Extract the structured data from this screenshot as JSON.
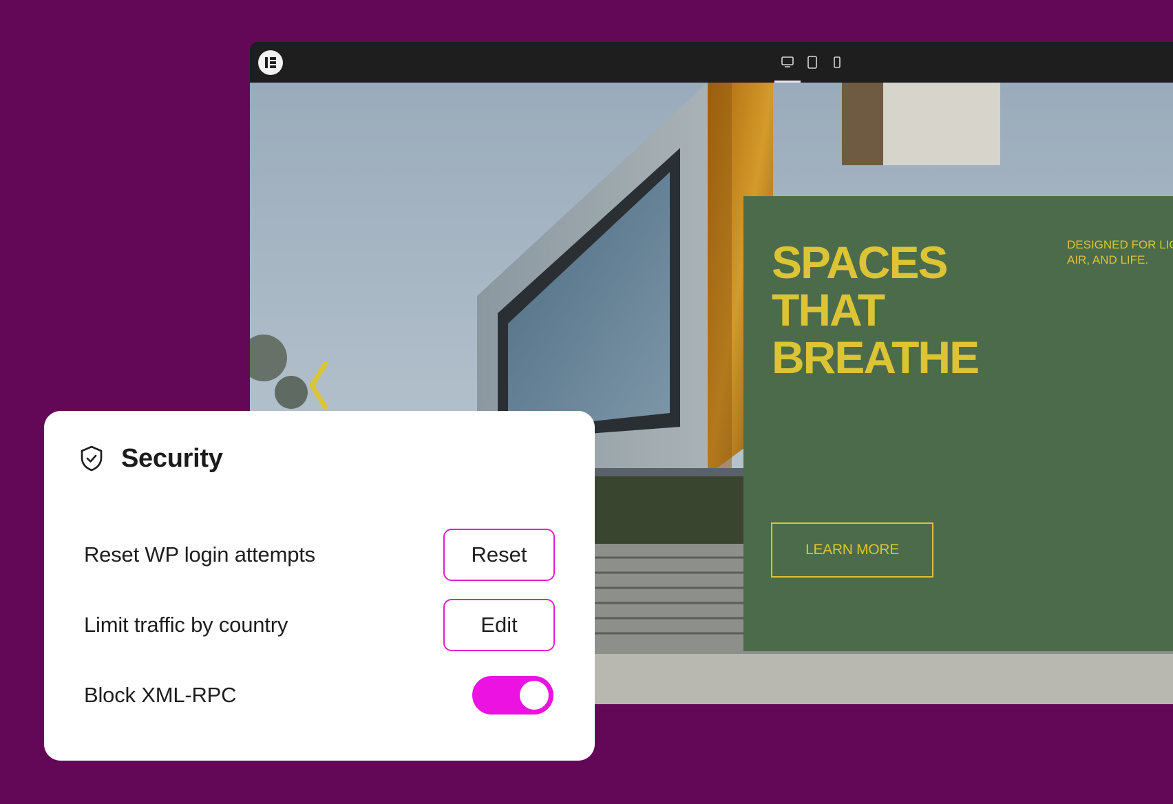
{
  "colors": {
    "background": "#630856",
    "accent": "#ec12e1",
    "panel_green": "#4c6b4a",
    "headline_yellow": "#dcc435"
  },
  "editor": {
    "logo_icon": "elementor-logo-icon",
    "devices": [
      {
        "name": "desktop",
        "icon": "desktop-icon",
        "active": true
      },
      {
        "name": "tablet",
        "icon": "tablet-icon",
        "active": false
      },
      {
        "name": "mobile",
        "icon": "mobile-icon",
        "active": false
      }
    ]
  },
  "hero": {
    "headline_lines": [
      "SPACES",
      "THAT",
      "BREATHE"
    ],
    "tagline_lines": [
      "DESIGNED FOR LIG",
      "AIR, AND LIFE."
    ],
    "cta_label": "LEARN MORE",
    "prev_icon": "chevron-left-icon"
  },
  "security": {
    "icon": "shield-check-icon",
    "title": "Security",
    "items": [
      {
        "label": "Reset WP login attempts",
        "control": "button",
        "button_label": "Reset"
      },
      {
        "label": "Limit traffic by country",
        "control": "button",
        "button_label": "Edit"
      },
      {
        "label": "Block XML-RPC",
        "control": "toggle",
        "toggle_on": true
      }
    ]
  }
}
